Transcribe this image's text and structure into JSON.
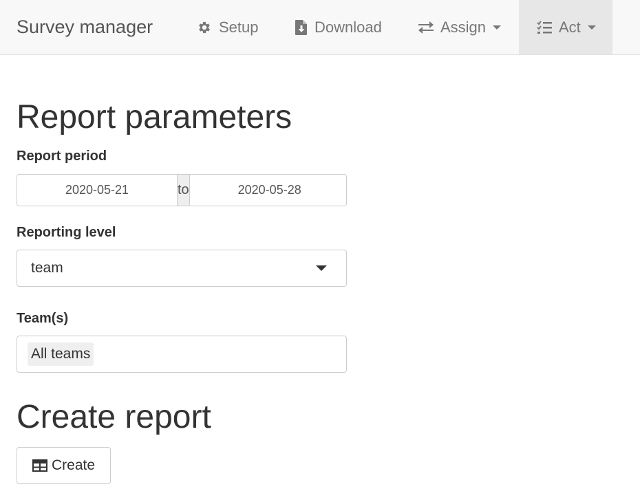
{
  "navbar": {
    "brand": "Survey manager",
    "items": [
      {
        "label": "Setup",
        "icon": "gear-icon"
      },
      {
        "label": "Download",
        "icon": "file-download-icon"
      },
      {
        "label": "Assign",
        "icon": "exchange-icon",
        "dropdown": true
      },
      {
        "label": "Act",
        "icon": "tasks-icon",
        "dropdown": true,
        "active": true
      }
    ]
  },
  "params": {
    "heading": "Report parameters",
    "period": {
      "label": "Report period",
      "start": "2020-05-21",
      "separator": "to",
      "end": "2020-05-28"
    },
    "level": {
      "label": "Reporting level",
      "value": "team"
    },
    "teams": {
      "label": "Team(s)",
      "selected": [
        "All teams"
      ]
    }
  },
  "create": {
    "heading": "Create report",
    "button_label": "Create",
    "button_icon": "table-icon"
  },
  "colors": {
    "navbar_bg": "#f8f8f8",
    "navbar_active_bg": "#e7e7e7",
    "text": "#333333",
    "nav_text": "#777777",
    "border": "#cccccc"
  }
}
